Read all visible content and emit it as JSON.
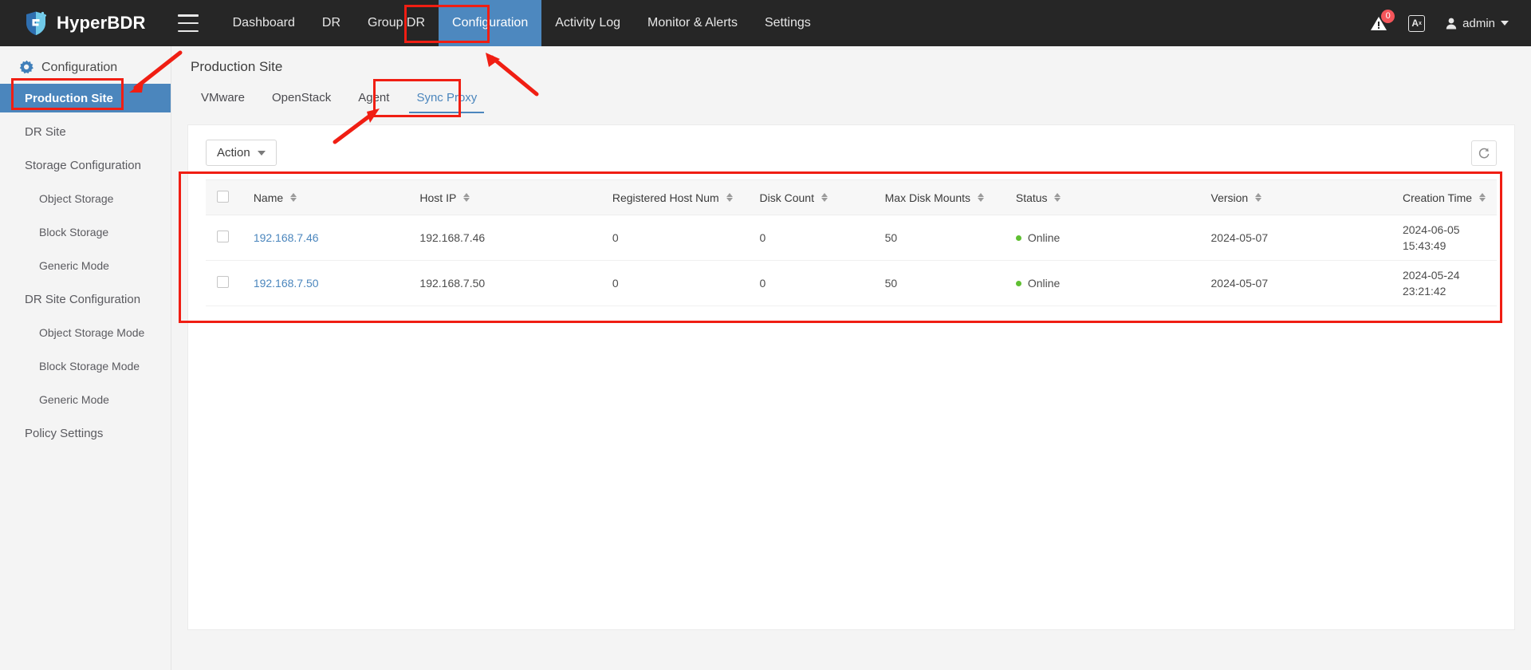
{
  "brand": {
    "name": "HyperBDR",
    "logo_icon": "shield-logo-icon",
    "accent": "#4b86bd"
  },
  "topnav": {
    "menu_icon": "hamburger-menu-icon",
    "items": [
      {
        "label": "Dashboard",
        "active": false
      },
      {
        "label": "DR",
        "active": false
      },
      {
        "label": "Group DR",
        "active": false
      },
      {
        "label": "Configuration",
        "active": true
      },
      {
        "label": "Activity Log",
        "active": false
      },
      {
        "label": "Monitor & Alerts",
        "active": false
      },
      {
        "label": "Settings",
        "active": false
      }
    ],
    "alerts": {
      "icon": "alert-bell-icon",
      "badge": "0",
      "badge_color": "#f5555a"
    },
    "language": {
      "icon": "language-icon",
      "label": "A",
      "sup": "x"
    },
    "user": {
      "icon": "user-avatar-icon",
      "name": "admin",
      "caret": "chevron-down-icon"
    }
  },
  "sidebar": {
    "header": {
      "icon": "gear-config-icon",
      "label": "Configuration"
    },
    "items": [
      {
        "label": "Production Site",
        "level": 1,
        "active": true
      },
      {
        "label": "DR Site",
        "level": 1,
        "active": false
      },
      {
        "label": "Storage Configuration",
        "level": 1,
        "active": false
      },
      {
        "label": "Object Storage",
        "level": 2,
        "active": false
      },
      {
        "label": "Block Storage",
        "level": 2,
        "active": false
      },
      {
        "label": "Generic Mode",
        "level": 2,
        "active": false
      },
      {
        "label": "DR Site Configuration",
        "level": 1,
        "active": false
      },
      {
        "label": "Object Storage Mode",
        "level": 2,
        "active": false
      },
      {
        "label": "Block Storage Mode",
        "level": 2,
        "active": false
      },
      {
        "label": "Generic Mode",
        "level": 2,
        "active": false
      },
      {
        "label": "Policy Settings",
        "level": 1,
        "active": false
      }
    ]
  },
  "main": {
    "page_title": "Production Site",
    "tabs": [
      {
        "label": "VMware",
        "active": false
      },
      {
        "label": "OpenStack",
        "active": false
      },
      {
        "label": "Agent",
        "active": false
      },
      {
        "label": "Sync Proxy",
        "active": true
      }
    ],
    "toolbar": {
      "action_label": "Action",
      "action_caret": "chevron-down-icon",
      "refresh_icon": "refresh-icon"
    },
    "table": {
      "columns": [
        "Name",
        "Host IP",
        "Registered Host Num",
        "Disk Count",
        "Max Disk Mounts",
        "Status",
        "Version",
        "Creation Time"
      ],
      "rows": [
        {
          "name": "192.168.7.46",
          "host_ip": "192.168.7.46",
          "registered_host_num": "0",
          "disk_count": "0",
          "max_disk_mounts": "50",
          "status": "Online",
          "status_color": "#5fbf32",
          "version": "2024-05-07",
          "creation_date": "2024-06-05",
          "creation_time": "15:43:49"
        },
        {
          "name": "192.168.7.50",
          "host_ip": "192.168.7.50",
          "registered_host_num": "0",
          "disk_count": "0",
          "max_disk_mounts": "50",
          "status": "Online",
          "status_color": "#5fbf32",
          "version": "2024-05-07",
          "creation_date": "2024-05-24",
          "creation_time": "23:21:42"
        }
      ]
    }
  },
  "annotations": {
    "color": "#f01e13"
  }
}
